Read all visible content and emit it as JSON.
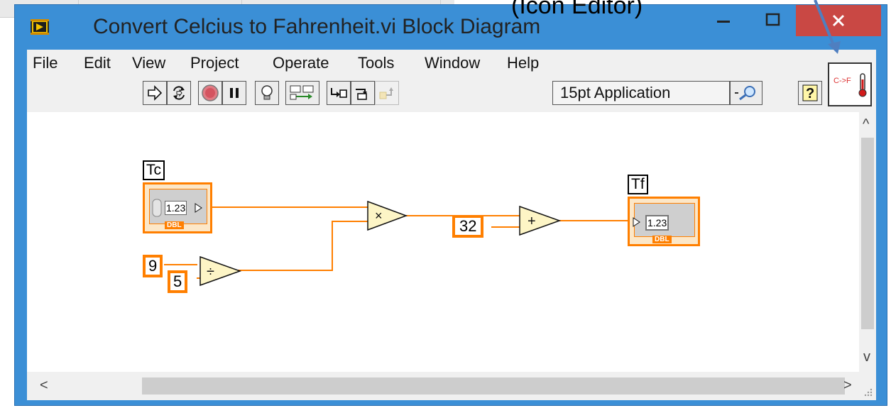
{
  "annotation": {
    "text": "(Icon Editor)"
  },
  "window": {
    "title": "Convert Celcius to Fahrenheit.vi Block Diagram",
    "controls": {
      "minimize": "–",
      "maximize": "☐",
      "close": "✕"
    }
  },
  "menubar": {
    "items": [
      "File",
      "Edit",
      "View",
      "Project",
      "Operate",
      "Tools",
      "Window",
      "Help"
    ]
  },
  "toolbar": {
    "icons": [
      "run-arrow-icon",
      "run-continuously-icon",
      "abort-icon",
      "pause-icon",
      "highlight-execution-icon",
      "retain-wire-values-icon",
      "step-into-icon",
      "step-over-icon",
      "step-out-icon"
    ],
    "font_selector": "15pt Application",
    "search_icon": "search-icon",
    "help_icon": "context-help-icon"
  },
  "vi_icon": {
    "text": "C->F"
  },
  "diagram": {
    "input_terminal": {
      "label": "Tc",
      "value": "1.23",
      "type": "DBL"
    },
    "output_terminal": {
      "label": "Tf",
      "value": "1.23",
      "type": "DBL"
    },
    "constants": {
      "nine": "9",
      "five": "5",
      "thirtytwo": "32"
    },
    "functions": {
      "divide": "÷",
      "multiply": "×",
      "add": "+"
    }
  },
  "scrollbar": {
    "up": "^",
    "down": "v",
    "left": "<",
    "right": ">"
  },
  "colors": {
    "wire": "#ff7f00",
    "titlebar": "#3b8fd6",
    "close": "#c94844",
    "function_fill": "#fdf5c6"
  }
}
